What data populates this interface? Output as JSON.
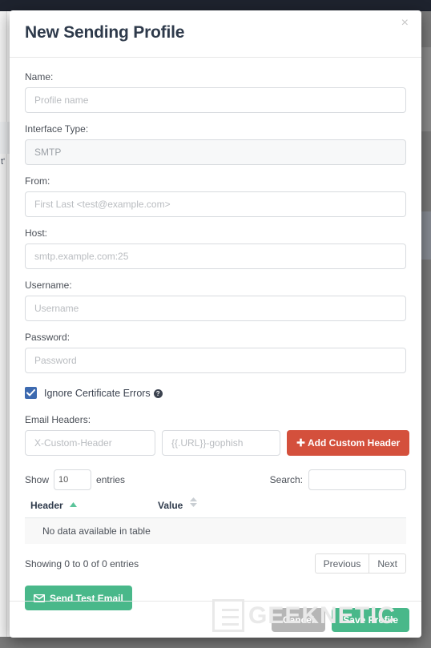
{
  "modal": {
    "title": "New Sending Profile",
    "close_label": "×",
    "fields": [
      {
        "label": "Name:",
        "placeholder": "Profile name",
        "value": "",
        "name": "name",
        "readonly": false
      },
      {
        "label": "Interface Type:",
        "placeholder": "SMTP",
        "value": "",
        "name": "interface-type",
        "readonly": true
      },
      {
        "label": "From:",
        "placeholder": "First Last <test@example.com>",
        "value": "",
        "name": "from",
        "readonly": false
      },
      {
        "label": "Host:",
        "placeholder": "smtp.example.com:25",
        "value": "",
        "name": "host",
        "readonly": false
      },
      {
        "label": "Username:",
        "placeholder": "Username",
        "value": "",
        "name": "username",
        "readonly": false
      },
      {
        "label": "Password:",
        "placeholder": "Password",
        "value": "",
        "name": "password",
        "readonly": false
      }
    ],
    "ignore_cert": {
      "label": "Ignore Certificate Errors",
      "checked": true,
      "help_glyph": "?"
    },
    "email_headers": {
      "label": "Email Headers:",
      "header_placeholder": "X-Custom-Header",
      "header_value": "",
      "value_placeholder": "{{.URL}}-gophish",
      "value_value": "",
      "add_button": "Add Custom Header",
      "add_icon": "plus-icon"
    },
    "datatable": {
      "show_label": "Show",
      "entries_label": "entries",
      "page_length": "10",
      "search_label": "Search:",
      "search_value": "",
      "search_placeholder": "",
      "columns": [
        "Header",
        "Value"
      ],
      "sort_state": [
        "asc",
        "none"
      ],
      "empty_message": "No data available in table",
      "info": "Showing 0 to 0 of 0 entries",
      "previous_label": "Previous",
      "next_label": "Next"
    },
    "send_test": {
      "label": "Send Test Email",
      "icon": "envelope-icon"
    },
    "footer": {
      "cancel_label": "Cancel",
      "save_label": "Save Profile"
    }
  },
  "watermark": {
    "text": "GEEKNETIC"
  },
  "colors": {
    "title": "#2e3a4b",
    "danger": "#d4503c",
    "success": "#49b88a",
    "muted": "#b6b6b6",
    "checkbox": "#3d6ab0",
    "topbar": "#1e232e"
  }
}
